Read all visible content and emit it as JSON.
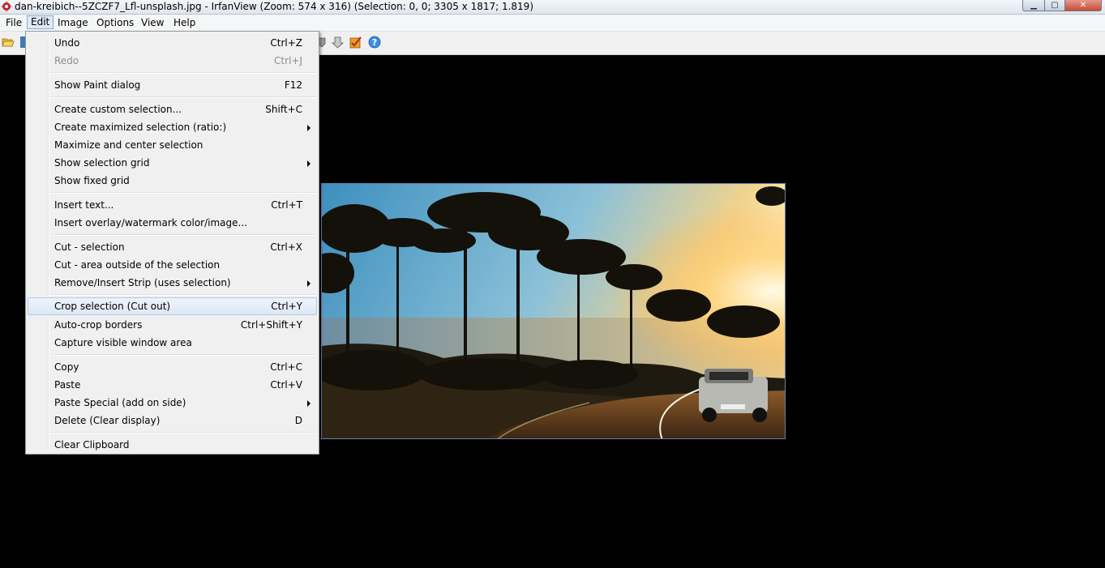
{
  "window": {
    "title": "dan-kreibich--5ZCZF7_Lfl-unsplash.jpg - IrfanView (Zoom: 574 x 316) (Selection: 0, 0; 3305 x 1817; 1.819)",
    "minimize_glyph": "▁",
    "maximize_glyph": "▢",
    "close_glyph": "✕"
  },
  "menubar": {
    "items": [
      "File",
      "Edit",
      "Image",
      "Options",
      "View",
      "Help"
    ]
  },
  "toolbar": {
    "icons": [
      "open-folder-icon",
      "save-icon",
      "prev-icon",
      "next-icon",
      "paint-check-icon",
      "help-icon"
    ],
    "help_glyph": "?"
  },
  "edit_menu": {
    "items": [
      {
        "label": "Undo",
        "shortcut": "Ctrl+Z"
      },
      {
        "label": "Redo",
        "shortcut": "Ctrl+J",
        "disabled": true
      },
      {
        "label": "Show Paint dialog",
        "shortcut": "F12"
      },
      {
        "label": "Create custom selection...",
        "shortcut": "Shift+C"
      },
      {
        "label": "Create maximized selection (ratio:)",
        "shortcut": "",
        "submenu": true
      },
      {
        "label": "Maximize and center selection",
        "shortcut": ""
      },
      {
        "label": "Show selection grid",
        "shortcut": "",
        "submenu": true
      },
      {
        "label": "Show fixed grid",
        "shortcut": ""
      },
      {
        "label": "Insert text...",
        "shortcut": "Ctrl+T"
      },
      {
        "label": "Insert overlay/watermark color/image...",
        "shortcut": ""
      },
      {
        "label": "Cut - selection",
        "shortcut": "Ctrl+X"
      },
      {
        "label": "Cut - area outside of the selection",
        "shortcut": ""
      },
      {
        "label": "Remove/Insert Strip (uses selection)",
        "shortcut": "",
        "submenu": true
      },
      {
        "label": "Crop selection (Cut out)",
        "shortcut": "Ctrl+Y",
        "highlighted": true
      },
      {
        "label": "Auto-crop borders",
        "shortcut": "Ctrl+Shift+Y"
      },
      {
        "label": "Capture visible window area",
        "shortcut": ""
      },
      {
        "label": "Copy",
        "shortcut": "Ctrl+C"
      },
      {
        "label": "Paste",
        "shortcut": "Ctrl+V"
      },
      {
        "label": "Paste Special (add on side)",
        "shortcut": "",
        "submenu": true
      },
      {
        "label": "Delete (Clear display)",
        "shortcut": "D"
      },
      {
        "label": "Clear Clipboard",
        "shortcut": ""
      }
    ]
  },
  "colors": {
    "highlight_bg": "#dde8f6",
    "highlight_border": "#aecbf1",
    "canvas_bg": "#000000"
  }
}
